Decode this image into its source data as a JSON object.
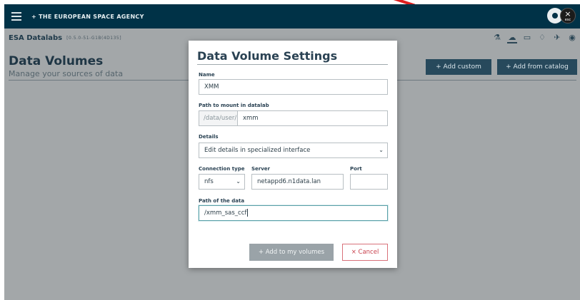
{
  "topbar": {
    "org_name": "+ THE EUROPEAN SPACE AGENCY",
    "close_label": "×",
    "close_hint": "esc"
  },
  "subbar": {
    "app_name": "ESA Datalabs",
    "version": "[0.5.0-51-G1B(4D135]",
    "icons": [
      "flask-icon",
      "cloud-icon",
      "folder-icon",
      "bell-icon",
      "satellite-icon",
      "user-icon"
    ]
  },
  "page": {
    "title": "Data Volumes",
    "subtitle": "Manage your sources of data",
    "add_custom_label": "+ Add custom",
    "add_catalog_label": "+ Add from catalog"
  },
  "modal": {
    "title": "Data Volume Settings",
    "name_label": "Name",
    "name_value": "XMM",
    "path_label": "Path to mount in datalab",
    "path_prefix": "/data/user/",
    "path_value": "xmm",
    "details_label": "Details",
    "details_value": "Edit details in specialized interface",
    "connection_type_label": "Connection type",
    "connection_type_value": "nfs",
    "server_label": "Server",
    "server_value": "netappd6.n1data.lan",
    "port_label": "Port",
    "port_value": "",
    "data_path_label": "Path of the data",
    "data_path_value": "/xmm_sas_ccf",
    "add_button_label": "+ Add to my volumes",
    "cancel_button_label": "× Cancel"
  },
  "colors": {
    "topbar": "#003247",
    "overlay": "#a3a7a9",
    "accent": "#27495c",
    "cancel": "#c9414d"
  }
}
